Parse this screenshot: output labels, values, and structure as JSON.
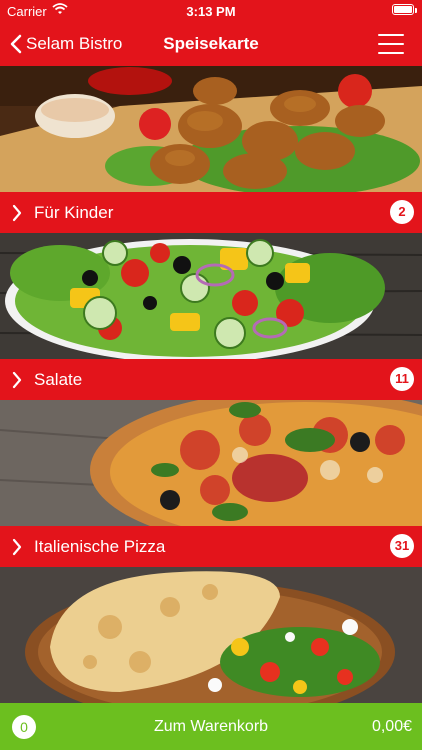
{
  "status": {
    "carrier": "Carrier",
    "time": "3:13 PM"
  },
  "nav": {
    "back_label": "Selam Bistro",
    "title": "Speisekarte"
  },
  "categories": [
    {
      "label": "Für Kinder",
      "count": "2"
    },
    {
      "label": "Salate",
      "count": "11"
    },
    {
      "label": "Italienische Pizza",
      "count": "31"
    }
  ],
  "cart": {
    "quantity": "0",
    "label": "Zum Warenkorb",
    "total": "0,00€"
  },
  "colors": {
    "brand_red": "#e3141b",
    "cart_green": "#6cbf1f"
  }
}
